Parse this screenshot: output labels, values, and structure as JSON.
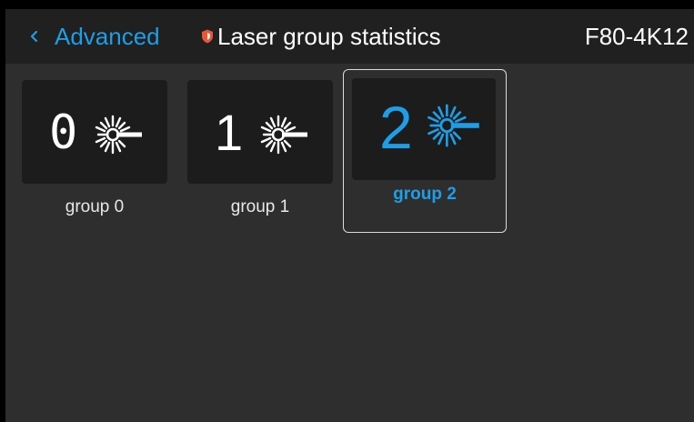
{
  "header": {
    "back_label": "Advanced",
    "title": "Laser group statistics",
    "model": "F80-4K12"
  },
  "groups": [
    {
      "number": "0",
      "label": "group 0",
      "selected": false
    },
    {
      "number": "1",
      "label": "group 1",
      "selected": false
    },
    {
      "number": "2",
      "label": "group 2",
      "selected": true
    }
  ],
  "icons": {
    "back": "chevron-left-icon",
    "title": "shield-icon",
    "group": "laser-icon"
  },
  "colors": {
    "accent": "#1e9ee6",
    "shield": "#e2583a",
    "background": "#2e2e2e",
    "header": "#202020",
    "card": "#1c1c1c"
  }
}
